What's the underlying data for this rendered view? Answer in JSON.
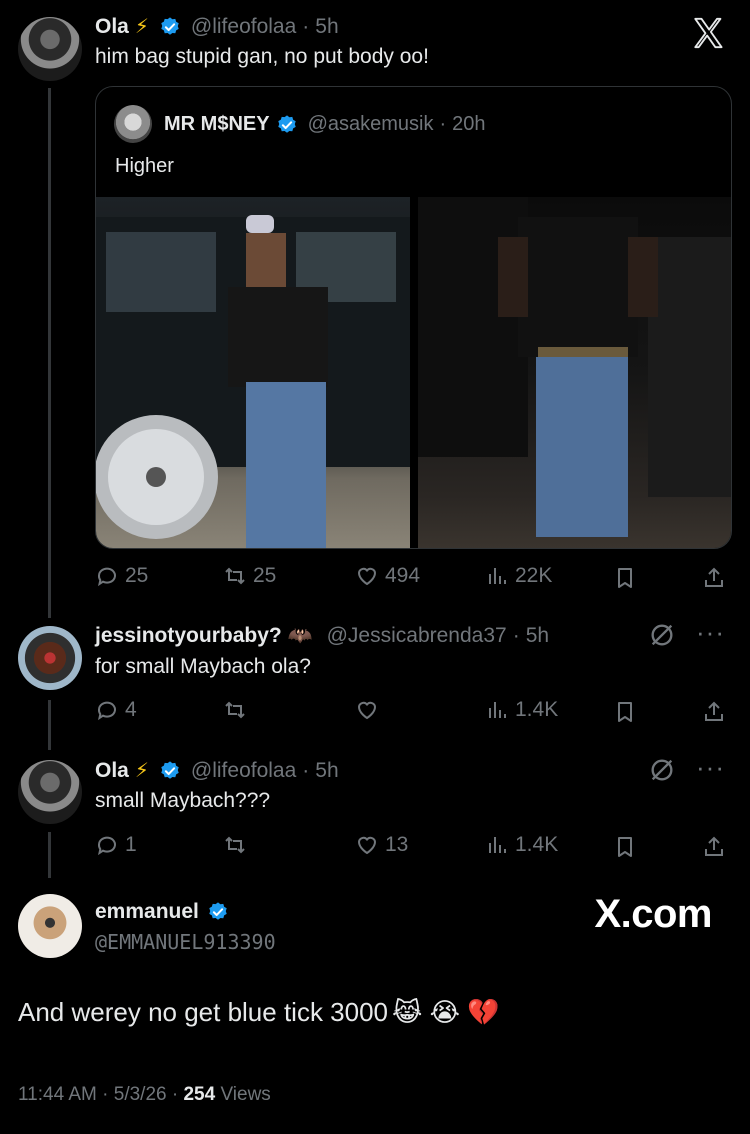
{
  "tweet1": {
    "name": "Ola",
    "name_emoji": "⚡",
    "handle": "@lifeofolaa",
    "time": "5h",
    "text": "him bag stupid gan, no put body oo!"
  },
  "quote": {
    "name": "MR M$NEY",
    "handle": "@asakemusik",
    "time": "20h",
    "text": "Higher"
  },
  "tweet1_stats": {
    "replies": "25",
    "reposts": "25",
    "likes": "494",
    "views": "22K"
  },
  "reply1": {
    "name": "jessinotyourbaby?",
    "name_emoji": "🦇",
    "handle": "@Jessicabrenda37",
    "time": "5h",
    "text": "for small Maybach ola?",
    "stats": {
      "replies": "4",
      "reposts": "",
      "likes": "",
      "views": "1.4K"
    }
  },
  "reply2": {
    "name": "Ola",
    "name_emoji": "⚡",
    "handle": "@lifeofolaa",
    "time": "5h",
    "text": "small Maybach???",
    "stats": {
      "replies": "1",
      "reposts": "",
      "likes": "13",
      "views": "1.4K"
    }
  },
  "main": {
    "name": "emmanuel",
    "handle": "@EMMANUEL913390",
    "text": "And werey no get blue tick 3000",
    "emojis": "😹 😭 💔",
    "time": "11:44 AM",
    "date": "5/3/26",
    "views_count": "254",
    "views_label": "Views",
    "watermark": "X.com"
  },
  "colors": {
    "background": "#000000",
    "text": "#e7e9ea",
    "muted": "#71767b",
    "verified": "#1d9bf0",
    "border": "#2f3336"
  }
}
